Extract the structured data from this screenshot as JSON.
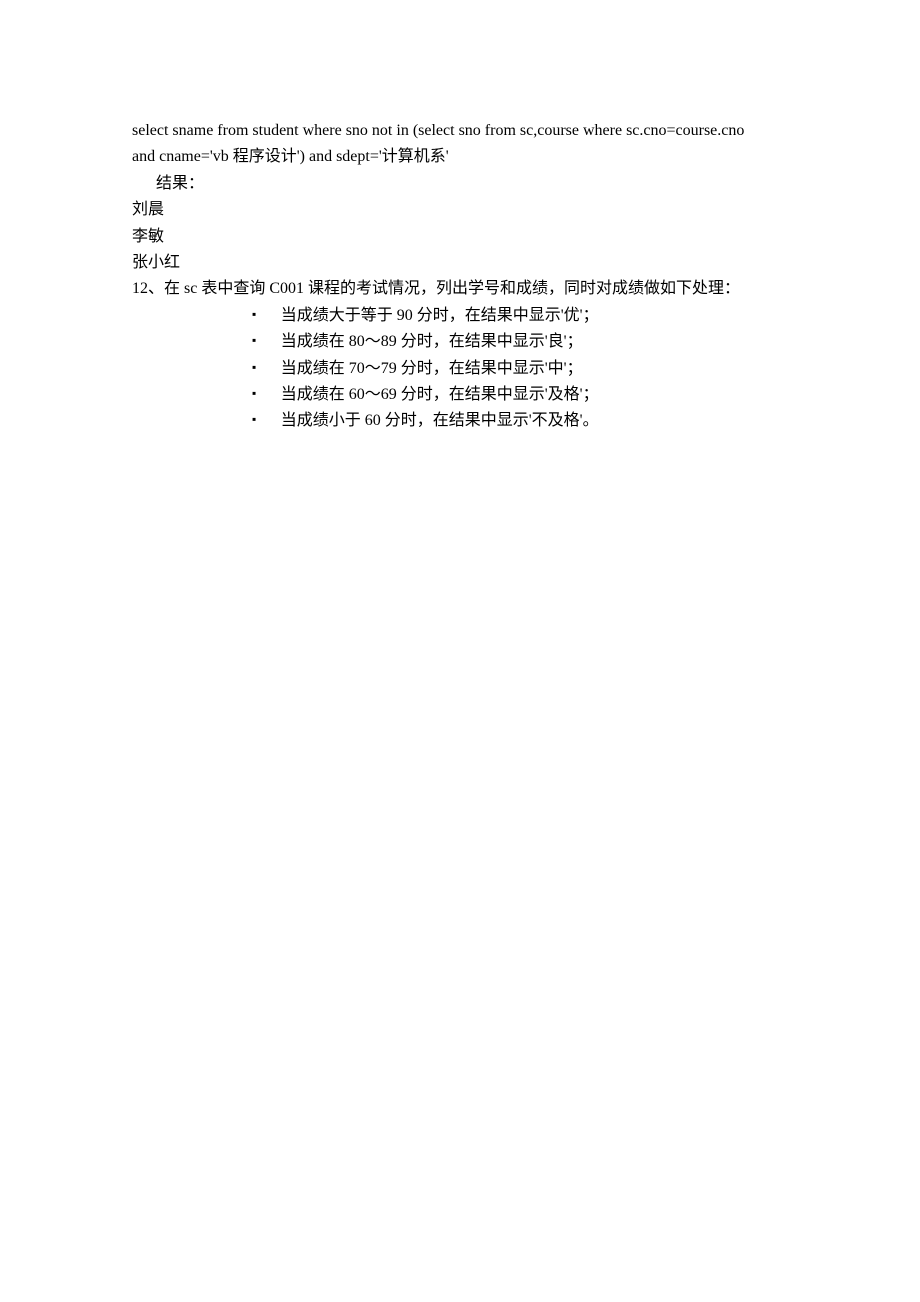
{
  "sql": {
    "line1": "select sname from student where sno not in (select sno from sc,course where sc.cno=course.cno",
    "line2": "and cname='vb 程序设计') and sdept='计算机系'"
  },
  "result_label": "结果：",
  "results": [
    "刘晨",
    "李敏",
    "张小红"
  ],
  "question12": "12、在 sc 表中查询 C001 课程的考试情况，列出学号和成绩，同时对成绩做如下处理：",
  "bullets": [
    "当成绩大于等于 90 分时，在结果中显示'优'；",
    "当成绩在 80～89 分时，在结果中显示'良'；",
    "当成绩在 70～79 分时，在结果中显示'中'；",
    "当成绩在 60～69 分时，在结果中显示'及格'；",
    "当成绩小于 60 分时，在结果中显示'不及格'。"
  ]
}
